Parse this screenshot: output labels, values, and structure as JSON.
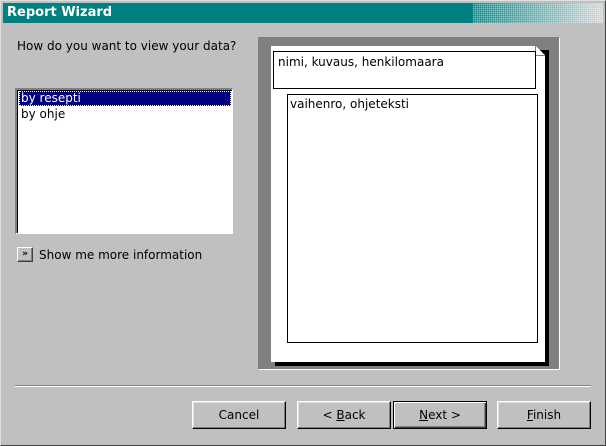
{
  "window": {
    "title": "Report Wizard"
  },
  "main": {
    "prompt": "How do you want to view your data?",
    "view_options": [
      {
        "label": "by resepti",
        "selected": true
      },
      {
        "label": "by ohje",
        "selected": false
      }
    ],
    "info_button_glyph": "»",
    "info_label": "Show me more information"
  },
  "preview": {
    "header_fields": "nimi, kuvaus, henkilomaara",
    "detail_fields": "vaihenro, ohjeteksti"
  },
  "buttons": {
    "cancel": "Cancel",
    "back_prefix": "< ",
    "back_mnemonic": "B",
    "back_rest": "ack",
    "next_mnemonic": "N",
    "next_rest": "ext >",
    "finish_mnemonic": "F",
    "finish_rest": "inish"
  },
  "colors": {
    "titlebar": "#008080",
    "selection": "#000080",
    "face": "#c0c0c0"
  }
}
